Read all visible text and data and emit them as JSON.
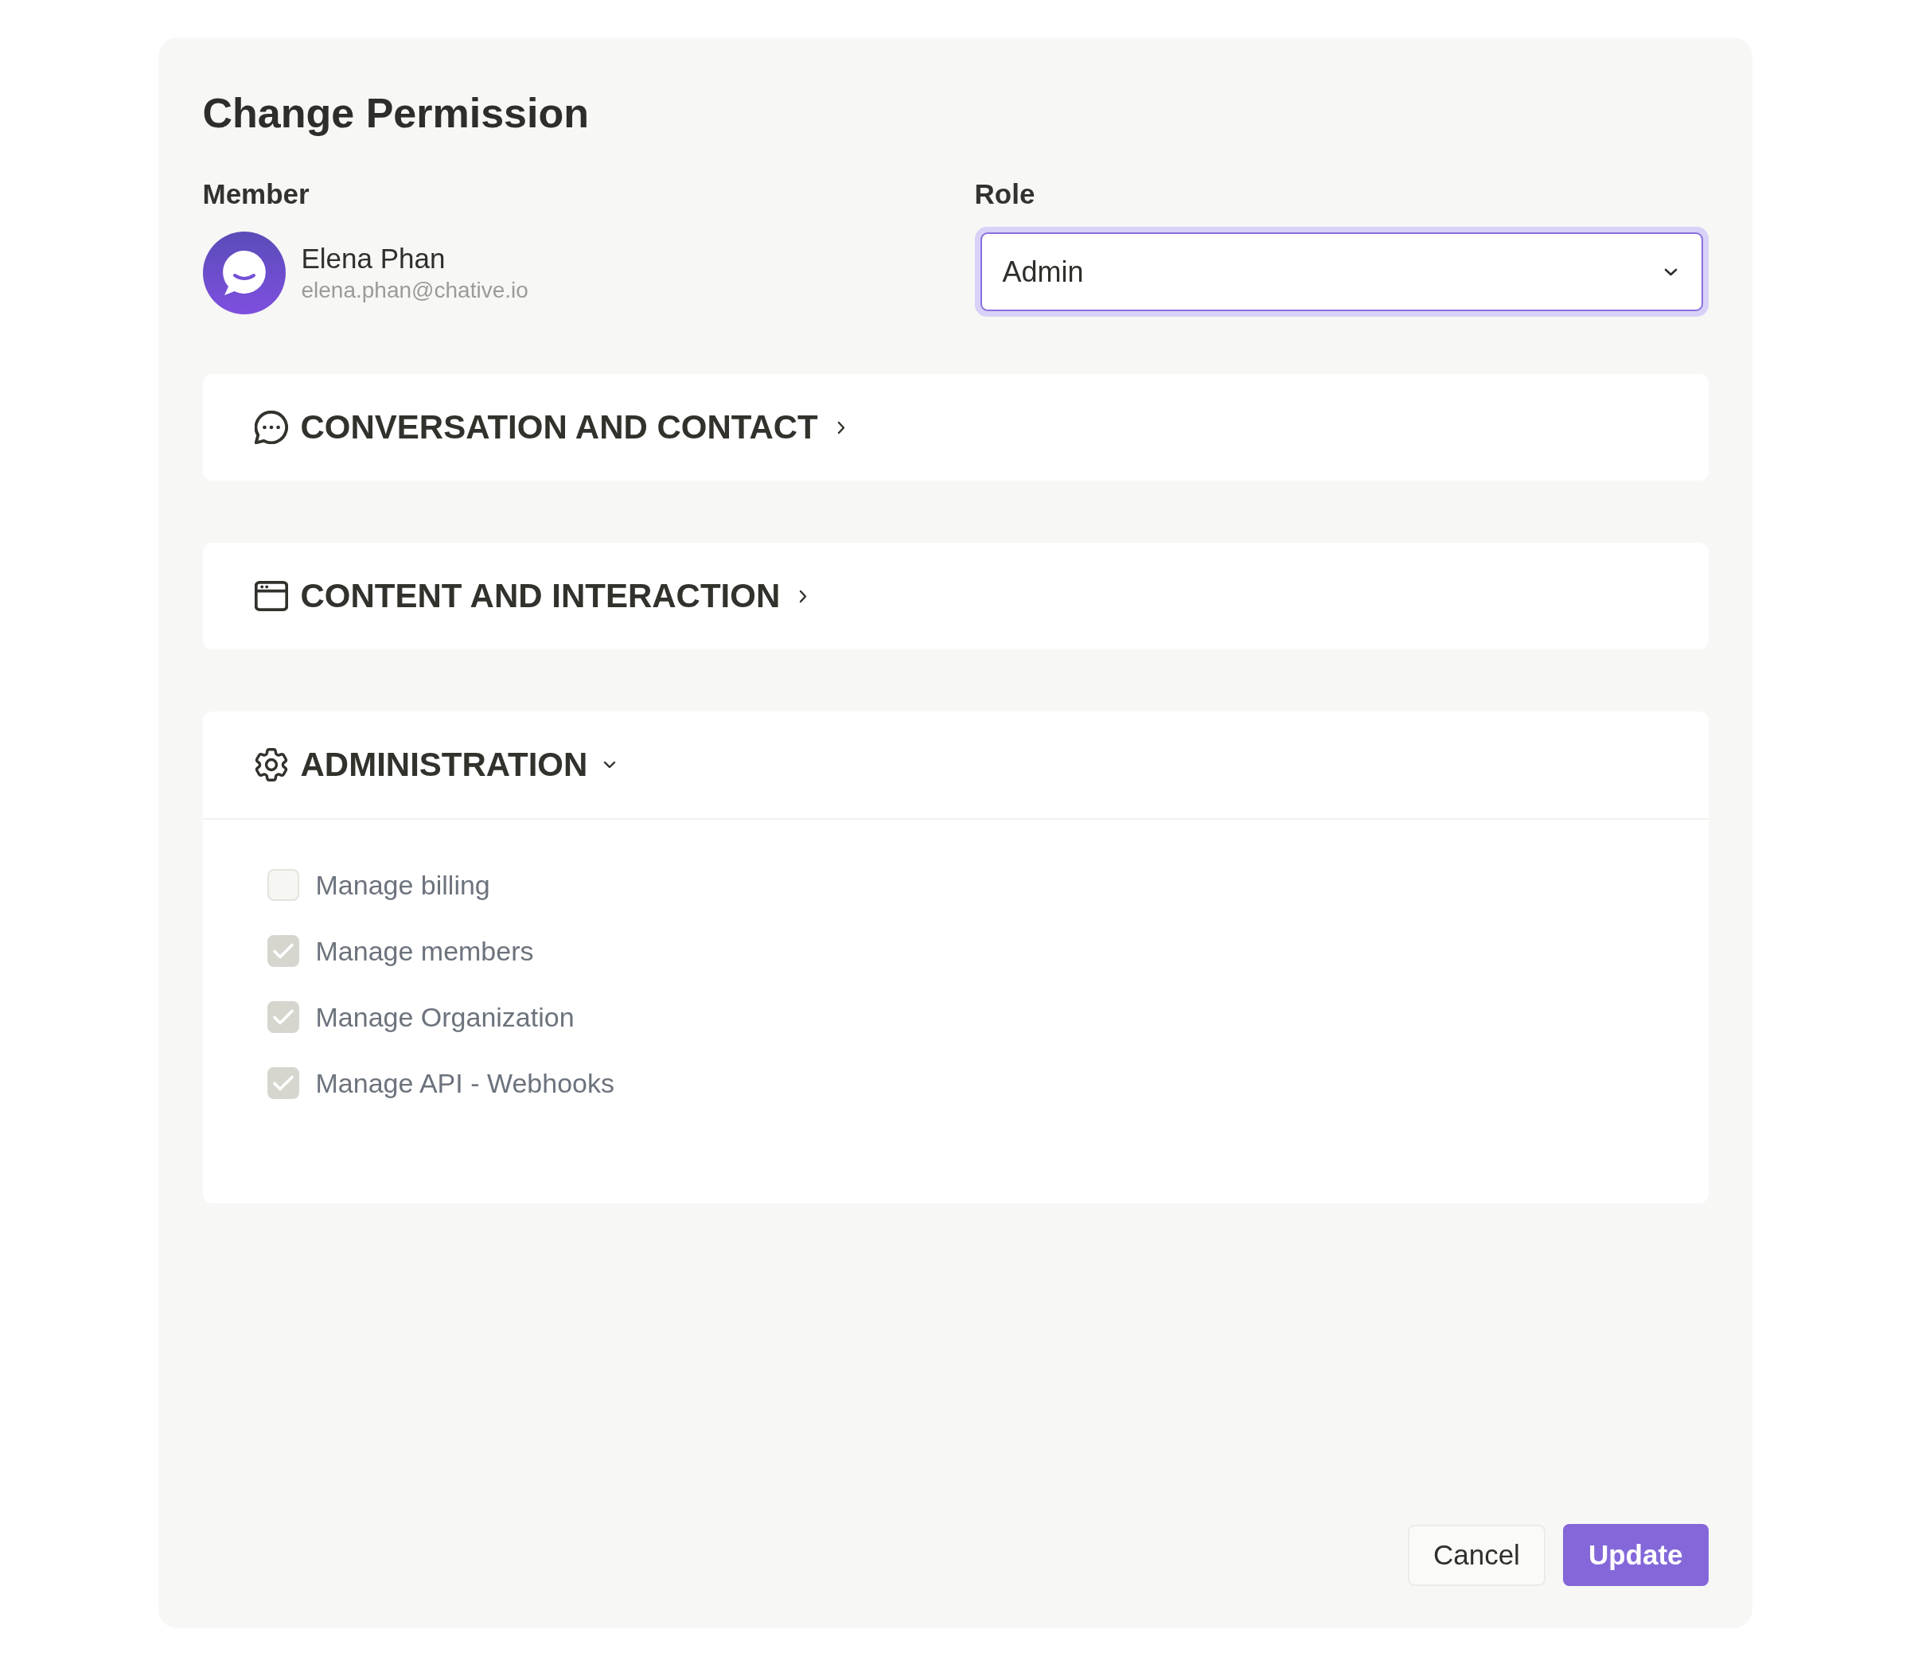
{
  "dialog": {
    "title": "Change Permission"
  },
  "member": {
    "label": "Member",
    "name": "Elena Phan",
    "email": "elena.phan@chative.io"
  },
  "role": {
    "label": "Role",
    "value": "Admin",
    "focused": true
  },
  "sections": [
    {
      "title": "CONVERSATION AND CONTACT",
      "expanded": false
    },
    {
      "title": "CONTENT AND INTERACTION",
      "expanded": false
    },
    {
      "title": "ADMINISTRATION",
      "expanded": true,
      "permissions": [
        {
          "label": "Manage billing",
          "checked": false,
          "disabled": true
        },
        {
          "label": "Manage members",
          "checked": true,
          "disabled": true
        },
        {
          "label": "Manage Organization",
          "checked": true,
          "disabled": true
        },
        {
          "label": "Manage API - Webhooks",
          "checked": true,
          "disabled": true
        }
      ]
    }
  ],
  "buttons": [
    {
      "label": "Cancel",
      "kind": "secondary"
    },
    {
      "label": "Update",
      "kind": "primary"
    }
  ]
}
